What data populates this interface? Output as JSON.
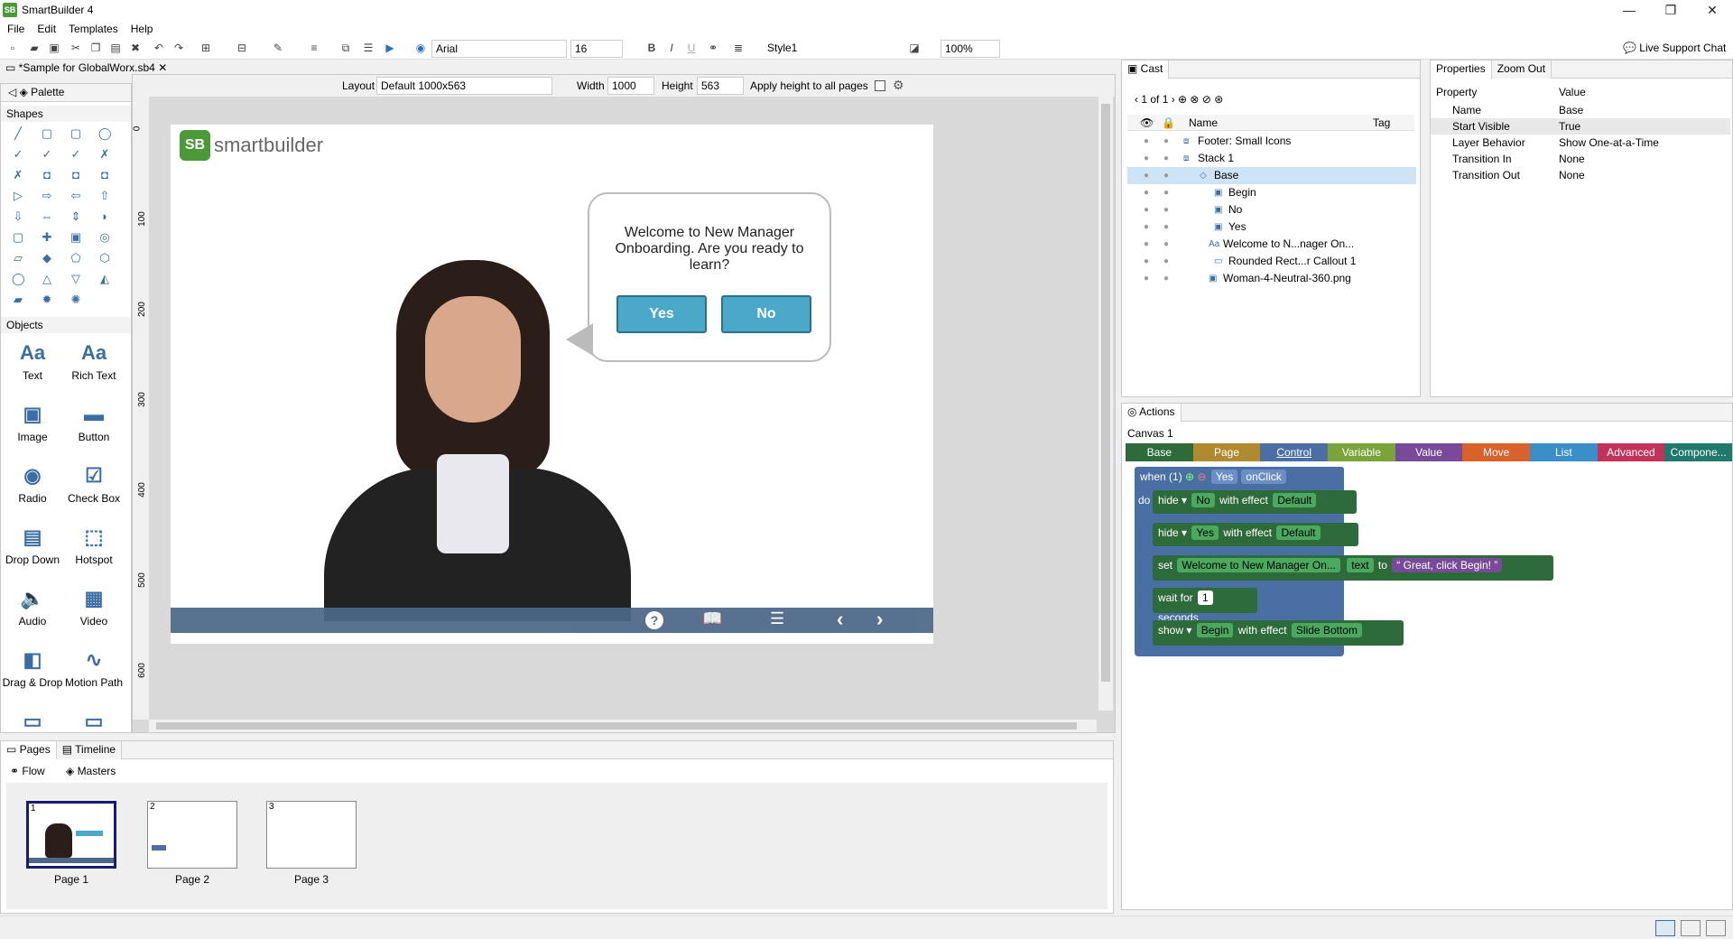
{
  "app": {
    "title": "SmartBuilder 4",
    "logo": "SB"
  },
  "window_controls": {
    "min": "—",
    "max": "❐",
    "close": "✕"
  },
  "menu": [
    "File",
    "Edit",
    "Templates",
    "Help"
  ],
  "toolbar": {
    "font": "Arial",
    "size": "16",
    "bold": "B",
    "italic": "I",
    "underline": "U",
    "style": "Style1",
    "zoom": "100%",
    "support": "Live Support Chat"
  },
  "editor": {
    "tab": "*Sample for GlobalWorx.sb4",
    "layout_label": "Layout",
    "layout_value": "Default 1000x563",
    "width_label": "Width",
    "width_value": "1000",
    "height_label": "Height",
    "height_value": "563",
    "apply_label": "Apply height to all pages",
    "ruler": [
      "0",
      "100",
      "200",
      "300",
      "400",
      "500",
      "600"
    ]
  },
  "palette": {
    "title": "Palette",
    "shapes_title": "Shapes",
    "objects_title": "Objects",
    "shape_icons": [
      "╱",
      "▢",
      "▢",
      "◯",
      "✓",
      "✓",
      "✓",
      "✗",
      "✗",
      "◘",
      "◘",
      "◘",
      "▷",
      "⇨",
      "⇦",
      "⇧",
      "⇩",
      "⇔",
      "⇕",
      "◗",
      "▢",
      "✚",
      "▣",
      "◎",
      "▱",
      "◆",
      "⬠",
      "⬡",
      "◯",
      "△",
      "▽",
      "◭",
      "▰",
      "✹",
      "✺"
    ],
    "objects": [
      {
        "label": "Text",
        "icon": "Aa"
      },
      {
        "label": "Rich Text",
        "icon": "Aa"
      },
      {
        "label": "Image",
        "icon": "▣"
      },
      {
        "label": "Button",
        "icon": "▬"
      },
      {
        "label": "Radio",
        "icon": "◉"
      },
      {
        "label": "Check Box",
        "icon": "☑"
      },
      {
        "label": "Drop Down",
        "icon": "▤"
      },
      {
        "label": "Hotspot",
        "icon": "⬚"
      },
      {
        "label": "Audio",
        "icon": "🔈"
      },
      {
        "label": "Video",
        "icon": "▦"
      },
      {
        "label": "Drag & Drop",
        "icon": "◧"
      },
      {
        "label": "Motion Path",
        "icon": "∿"
      },
      {
        "label": "Text Input",
        "icon": "▭"
      },
      {
        "label": "Number Input",
        "icon": "▭"
      }
    ]
  },
  "canvas": {
    "logo": "smartbuilder",
    "bubble_text": "Welcome to New Manager Onboarding. Are you ready to learn?",
    "yes": "Yes",
    "no": "No"
  },
  "cast": {
    "title": "Cast",
    "pager": "1 of 1",
    "col_name": "Name",
    "col_tag": "Tag",
    "items": [
      "Footer: Small Icons",
      "Stack 1",
      "Base",
      "Begin",
      "No",
      "Yes",
      "Welcome to N...nager On...",
      "Rounded Rect...r Callout 1",
      "Woman-4-Neutral-360.png"
    ]
  },
  "properties": {
    "tab1": "Properties",
    "tab2": "Zoom Out",
    "col_prop": "Property",
    "col_val": "Value",
    "rows": [
      {
        "k": "Name",
        "v": "Base"
      },
      {
        "k": "Start Visible",
        "v": "True"
      },
      {
        "k": "Layer Behavior",
        "v": "Show One-at-a-Time"
      },
      {
        "k": "Transition In",
        "v": "None"
      },
      {
        "k": "Transition Out",
        "v": "None"
      }
    ]
  },
  "actions": {
    "title": "Actions",
    "canvas": "Canvas 1",
    "categories": [
      {
        "name": "Base",
        "color": "#2e6b3a"
      },
      {
        "name": "Page",
        "color": "#b08a2e"
      },
      {
        "name": "Control",
        "color": "#4a6fa5"
      },
      {
        "name": "Variable",
        "color": "#7aa33a"
      },
      {
        "name": "Value",
        "color": "#7a4a9a"
      },
      {
        "name": "Move",
        "color": "#d9622b"
      },
      {
        "name": "List",
        "color": "#3b8fc8"
      },
      {
        "name": "Advanced",
        "color": "#c2325a"
      },
      {
        "name": "Compone...",
        "color": "#1f7a6b"
      }
    ],
    "when": "when (1)",
    "when_obj": "Yes",
    "when_evt": "onClick",
    "do": "do",
    "hide": "hide",
    "hide1_obj": "No",
    "hide2_obj": "Yes",
    "with_effect": "with effect",
    "default": "Default",
    "set": "set",
    "set_obj": "Welcome to New Manager On...",
    "set_prop": "text",
    "to": "to",
    "set_val": "Great, click Begin!",
    "wait_for": "wait for",
    "wait_n": "1",
    "seconds": "seconds",
    "show": "show",
    "show_obj": "Begin",
    "show_effect": "Slide Bottom"
  },
  "pages": {
    "tab1": "Pages",
    "tab2": "Timeline",
    "sub1": "Flow",
    "sub2": "Masters",
    "thumbs": [
      {
        "num": "1",
        "label": "Page 1"
      },
      {
        "num": "2",
        "label": "Page 2"
      },
      {
        "num": "3",
        "label": "Page 3"
      }
    ]
  }
}
